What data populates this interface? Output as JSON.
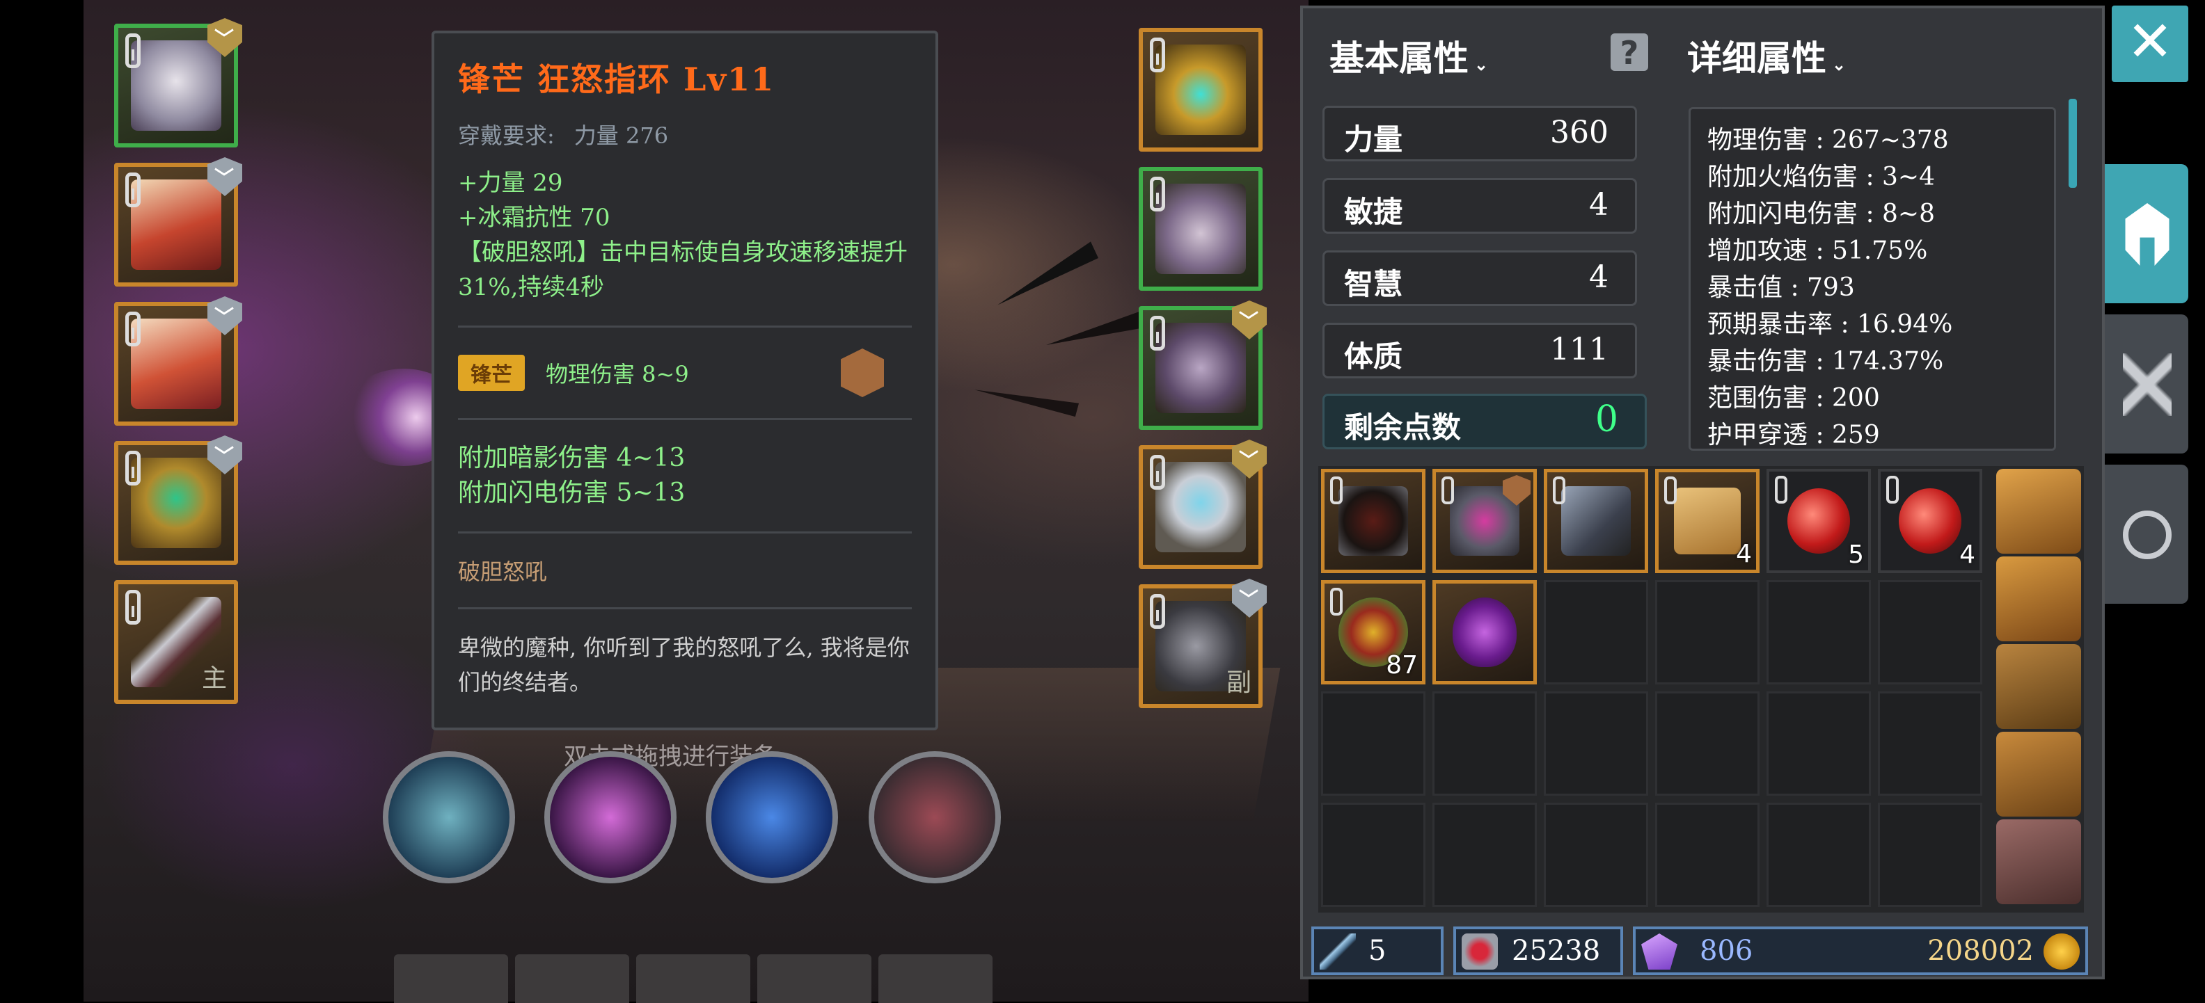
{
  "tooltip": {
    "title": "锋芒 狂怒指环 Lv11",
    "requirement_label": "穿戴要求:",
    "requirement_value": "力量 276",
    "stats": [
      "+力量 29",
      "+冰霜抗性 70",
      "【破胆怒吼】击中目标使自身攻速移速提升31%,持续4秒"
    ],
    "prefix_badge": "锋芒",
    "prefix_stat": "物理伤害 8~9",
    "extra_stats": [
      "附加暗影伤害 4~13",
      "附加闪电伤害 5~13"
    ],
    "skill_name": "破胆怒吼",
    "lore": "卑微的魔种, 你听到了我的怒吼了么, 我将是你们的终结者。"
  },
  "hint": "双击或拖拽进行装备",
  "equipment_left": [
    {
      "name": "helmet",
      "quality": "green",
      "badge": "gold"
    },
    {
      "name": "chest-armor",
      "quality": "orange",
      "badge": "silver"
    },
    {
      "name": "leg-armor",
      "quality": "orange",
      "badge": "silver"
    },
    {
      "name": "ring",
      "quality": "orange",
      "badge": "silver"
    },
    {
      "name": "main-weapon",
      "quality": "orange",
      "badge": "none",
      "tag": "主"
    }
  ],
  "equipment_right": [
    {
      "name": "amulet",
      "quality": "orange",
      "badge": "none"
    },
    {
      "name": "gloves",
      "quality": "green",
      "badge": "none"
    },
    {
      "name": "boots",
      "quality": "green",
      "badge": "gold"
    },
    {
      "name": "ring",
      "quality": "orange",
      "badge": "gold"
    },
    {
      "name": "off-hand",
      "quality": "orange",
      "badge": "silver",
      "tag": "副"
    }
  ],
  "basic_attributes": {
    "title": "基本属性",
    "caret": "⌄",
    "rows": [
      {
        "label": "力量",
        "value": "360"
      },
      {
        "label": "敏捷",
        "value": "4"
      },
      {
        "label": "智慧",
        "value": "4"
      },
      {
        "label": "体质",
        "value": "111"
      }
    ],
    "points_label": "剩余点数",
    "points_value": "0"
  },
  "detail_attributes": {
    "title": "详细属性",
    "caret": "⌄",
    "rows": [
      "物理伤害 : 267~378",
      "附加火焰伤害 : 3~4",
      "附加闪电伤害 : 8~8",
      "增加攻速 : 51.75%",
      "暴击值 : 793",
      "预期暴击率 : 16.94%",
      "暴击伤害 : 174.37%",
      "范围伤害 : 200",
      "护甲穿透 : 259"
    ]
  },
  "inventory": [
    {
      "item": "dark-orb-ring",
      "count": ""
    },
    {
      "item": "purple-gem-ring",
      "count": ""
    },
    {
      "item": "steel-gauntlet",
      "count": ""
    },
    {
      "item": "scroll",
      "count": "4"
    },
    {
      "item": "red-potion",
      "count": "5"
    },
    {
      "item": "red-potion",
      "count": "4"
    },
    {
      "item": "spiral-scroll",
      "count": "87"
    },
    {
      "item": "purple-flask",
      "count": ""
    }
  ],
  "currency": {
    "wands": "5",
    "hearts": "25238",
    "crystals": "806",
    "gold": "208002"
  },
  "colors": {
    "accent": "#3fa6b3",
    "title_orange": "#ff6a1a",
    "stat_green": "#8ef08a",
    "legendary_border": "#c9862b",
    "rare_border": "#3fae4a"
  }
}
